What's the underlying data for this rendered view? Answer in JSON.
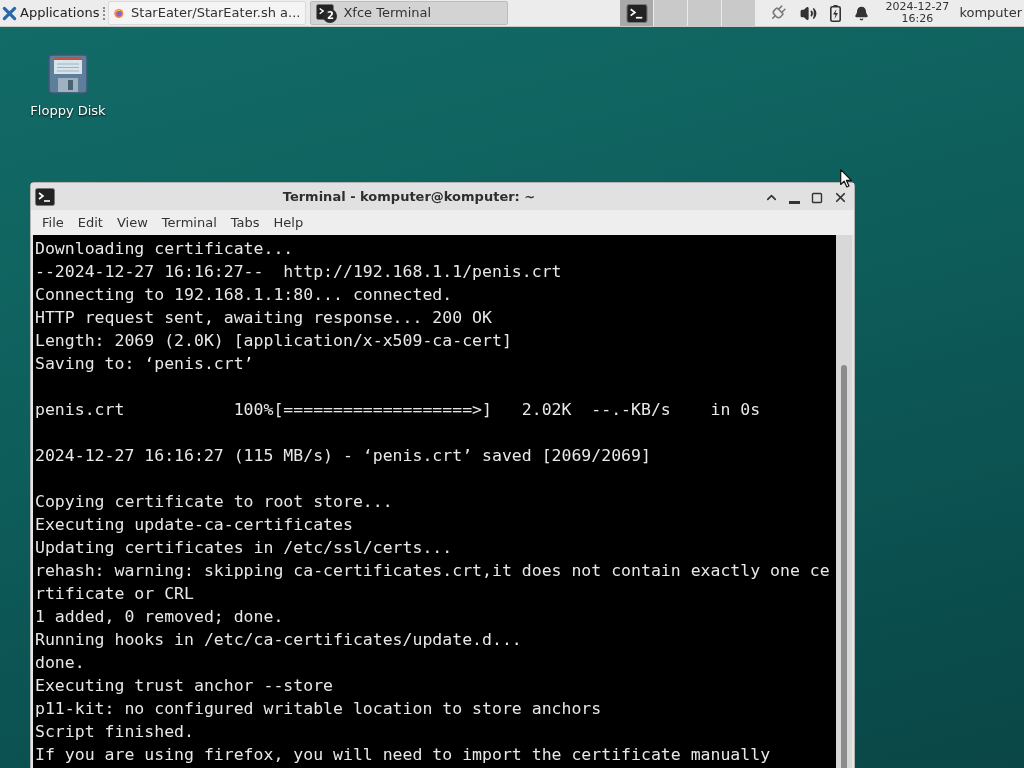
{
  "panel": {
    "applications_menu": {
      "label": "Applications"
    },
    "tasks": [
      {
        "kind": "browser",
        "label": "StarEater/StarEater.sh a...",
        "selected": false
      },
      {
        "kind": "terminal",
        "label": "Xfce Terminal",
        "badge": "2",
        "selected": true
      }
    ],
    "workspaces": [
      {
        "selected": true,
        "has_window": true
      },
      {
        "selected": false,
        "has_window": false
      },
      {
        "selected": false,
        "has_window": false
      },
      {
        "selected": false,
        "has_window": false
      }
    ],
    "clock": {
      "date": "2024-12-27",
      "time": "16:26"
    },
    "user": "komputer"
  },
  "desktop_icons": [
    {
      "label": "Floppy Disk"
    }
  ],
  "terminal_window": {
    "title": "Terminal - komputer@komputer: ~",
    "menu": [
      "File",
      "Edit",
      "View",
      "Terminal",
      "Tabs",
      "Help"
    ],
    "output_blocks": [
      [
        "Downloading certificate...",
        "--2024-12-27 16:16:27--  http://192.168.1.1/penis.crt",
        "Connecting to 192.168.1.1:80... connected.",
        "HTTP request sent, awaiting response... 200 OK",
        "Length: 2069 (2.0K) [application/x-x509-ca-cert]",
        "Saving to: ‘penis.crt’"
      ],
      [
        "penis.crt           100%[===================>]   2.02K  --.-KB/s    in 0s"
      ],
      [
        "2024-12-27 16:16:27 (115 MB/s) - ‘penis.crt’ saved [2069/2069]"
      ],
      [
        "Copying certificate to root store...",
        "Executing update-ca-certificates",
        "Updating certificates in /etc/ssl/certs...",
        "rehash: warning: skipping ca-certificates.crt,it does not contain exactly one ce",
        "rtificate or CRL",
        "1 added, 0 removed; done.",
        "Running hooks in /etc/ca-certificates/update.d...",
        "done.",
        "Executing trust anchor --store",
        "p11-kit: no configured writable location to store anchors",
        "Script finished.",
        "If you are using firefox, you will need to import the certificate manually"
      ]
    ]
  }
}
